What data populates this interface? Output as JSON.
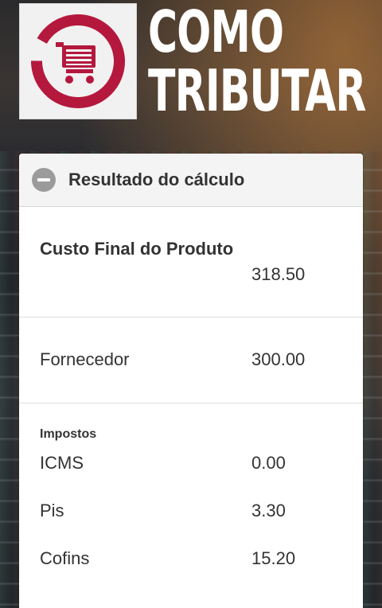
{
  "brand": {
    "line1": "COMO",
    "line2": "TRIBUTAR",
    "logo_icon": "shopping-cart-icon",
    "logo_color": "#b5183d"
  },
  "card": {
    "title": "Resultado do cálculo",
    "collapse_icon": "minus-circle-icon",
    "final_cost": {
      "label": "Custo Final do Produto",
      "value": "318.50"
    },
    "supplier": {
      "label": "Fornecedor",
      "value": "300.00"
    },
    "taxes": {
      "heading": "Impostos",
      "items": [
        {
          "label": "ICMS",
          "value": "0.00"
        },
        {
          "label": "Pis",
          "value": "3.30"
        },
        {
          "label": "Cofins",
          "value": "15.20"
        }
      ]
    }
  }
}
